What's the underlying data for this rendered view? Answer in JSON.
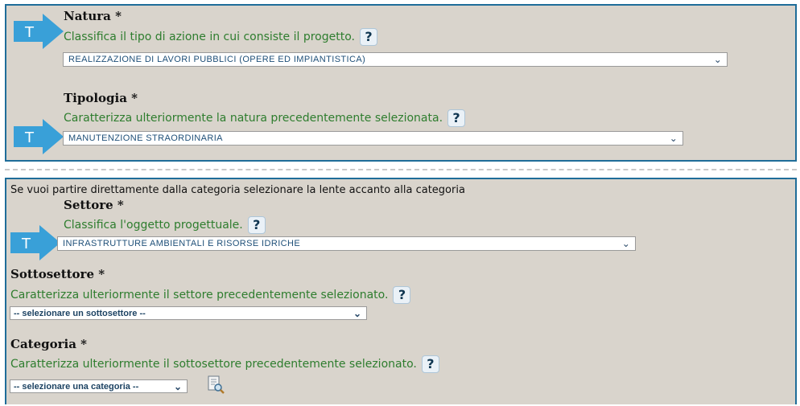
{
  "natura": {
    "label": "Natura *",
    "description": "Classifica il tipo di azione in cui consiste il progetto.",
    "help": "?",
    "selected": "REALIZZAZIONE DI LAVORI PUBBLICI (OPERE ED IMPIANTISTICA)",
    "arrow_letter": "T"
  },
  "tipologia": {
    "label": "Tipologia *",
    "description": "Caratterizza ulteriormente la natura precedentemente selezionata.",
    "help": "?",
    "selected": "MANUTENZIONE STRAORDINARIA",
    "arrow_letter": "T"
  },
  "info_text": "Se vuoi partire direttamente dalla categoria selezionare la lente accanto alla categoria",
  "settore": {
    "label": "Settore *",
    "description": "Classifica l'oggetto progettuale.",
    "help": "?",
    "selected": "INFRASTRUTTURE AMBIENTALI E RISORSE IDRICHE",
    "arrow_letter": "T"
  },
  "sottosettore": {
    "label": "Sottosettore *",
    "description": "Caratterizza ulteriormente il settore precedentemente selezionato.",
    "help": "?",
    "selected": "-- selezionare un sottosettore --"
  },
  "categoria": {
    "label": "Categoria *",
    "description": "Caratterizza ulteriormente il sottosettore precedentemente selezionato.",
    "help": "?",
    "selected": "-- selezionare una categoria --"
  },
  "colors": {
    "panel_bg": "#d9d4cc",
    "panel_border": "#1f6d99",
    "arrow": "#39a0d8",
    "description_text": "#2e7d2e",
    "select_text": "#1e4f78"
  },
  "icons": {
    "arrow": "t-arrow-icon",
    "help": "question-mark-icon",
    "dropdown": "chevron-down-icon",
    "lens": "document-magnifier-icon"
  }
}
